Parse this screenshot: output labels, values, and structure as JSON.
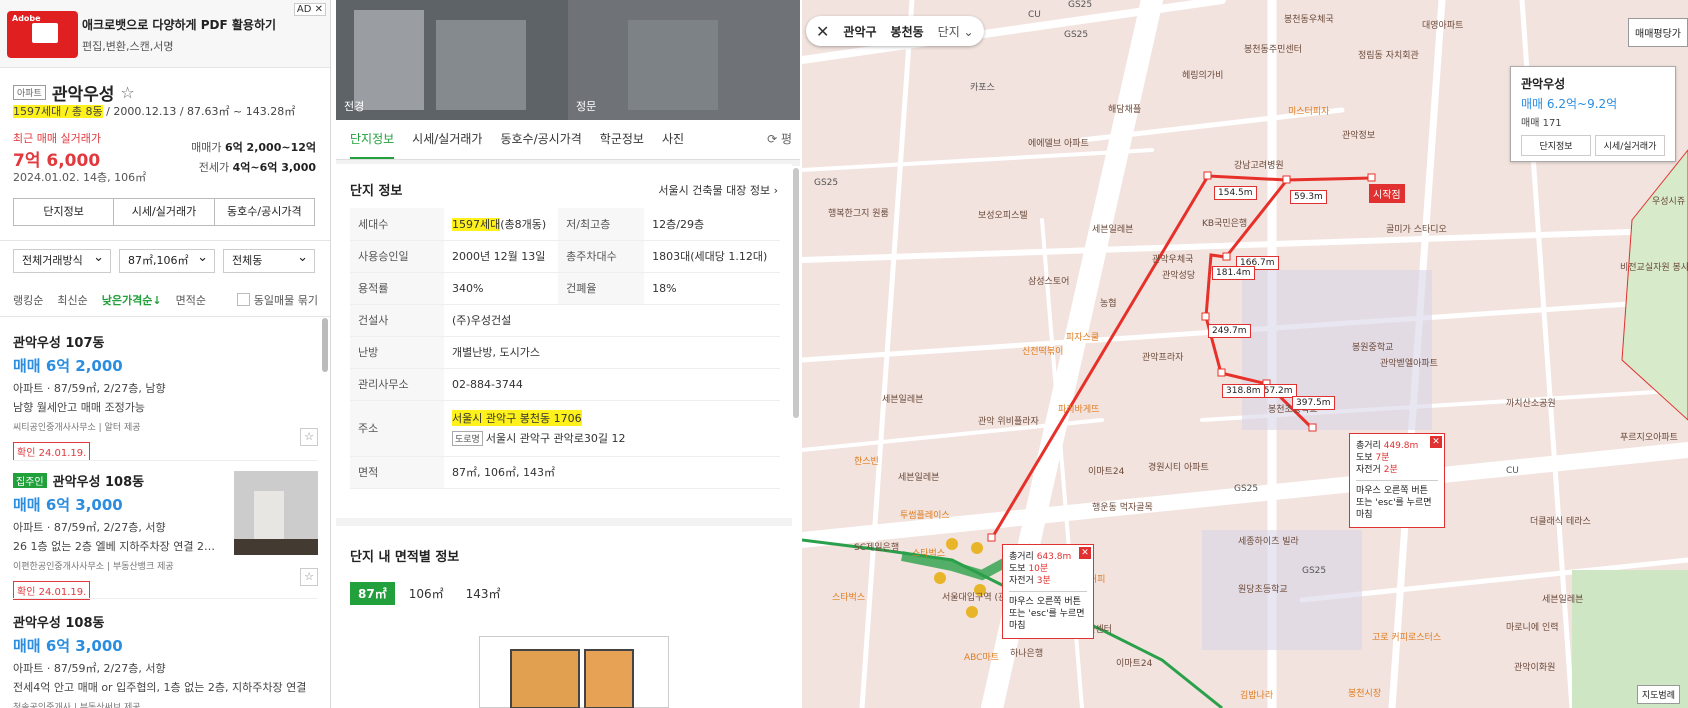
{
  "ad": {
    "title": "애크로뱃으로 다양하게 PDF 활용하기",
    "desc": "편집,변환,스캔,서명",
    "close": "AD ✕",
    "logo": "Adobe"
  },
  "complex": {
    "tag": "아파트",
    "name": "관악우성",
    "units_hl": "1597세대 / 총 8동",
    "spec_rest": " / 2000.12.13 / 87.63㎡ ~ 143.28㎡",
    "recent_label": "최근 매매 실거래가",
    "recent_price": "7억 6,000",
    "recent_date": "2024.01.02. 14층, 106㎡",
    "sale_label": "매매가",
    "sale_value": "6억 2,000~12억",
    "jeonse_label": "전세가",
    "jeonse_value": "4억~6억 3,000"
  },
  "left_buttons": [
    "단지정보",
    "시세/실거래가",
    "동호수/공시가격"
  ],
  "filters": [
    "전체거래방식",
    "87㎡,106㎡",
    "전체동"
  ],
  "sorts": {
    "items": [
      "랭킹순",
      "최신순",
      "낮은가격순↓",
      "면적순"
    ],
    "same": "동일매물 묶기"
  },
  "listings": [
    {
      "title": "관악우성 107동",
      "price": "매매 6억 2,000",
      "spec": "아파트 · 87/59㎡, 2/27층, 남향",
      "desc": "남향 월세안고 매매 조정가능",
      "src": "씨티공인중개사사무소 | 알터 제공",
      "check": "확인 24.01.19."
    },
    {
      "badge": "집주인",
      "title": "관악우성 108동",
      "price": "매매 6억 3,000",
      "spec": "아파트 · 87/59㎡, 2/27층, 서향",
      "desc": "26 1층 없는 2층 엘베 지하주차장 연결 2호...",
      "src": "이편한공인중개사사무소 | 부동산뱅크 제공",
      "check": "확인 24.01.19."
    },
    {
      "title": "관악우성 108동",
      "price": "매매 6억 3,000",
      "spec": "아파트 · 87/59㎡, 2/27층, 서향",
      "desc": "전세4억 안고 매매 or 입주협의, 1층 없는 2층, 지하주차장 연결",
      "src": "청솔공인중개사 | 부동산써브 제공"
    }
  ],
  "photos": [
    "전경",
    "정문"
  ],
  "tabs": [
    "단지정보",
    "시세/실거래가",
    "동호수/공시가격",
    "학군정보",
    "사진",
    "⟳ 평"
  ],
  "info": {
    "title": "단지 정보",
    "bldg_link": "서울시 건축물 대장 정보 ›",
    "rows": [
      {
        "k": "세대수",
        "v_hl": "1597세대",
        "v": "(총8개동)",
        "k2": "저/최고층",
        "v2": "12층/29층"
      },
      {
        "k": "사용승인일",
        "v": "2000년 12월 13일",
        "k2": "총주차대수",
        "v2": "1803대(세대당 1.12대)"
      },
      {
        "k": "용적률",
        "v": "340%",
        "k2": "건폐율",
        "v2": "18%"
      },
      {
        "k": "건설사",
        "v": "(주)우성건설"
      },
      {
        "k": "난방",
        "v": "개별난방, 도시가스"
      },
      {
        "k": "관리사무소",
        "v": "02-884-3744"
      },
      {
        "k": "주소",
        "v_hl": "서울시 관악구 봉천동 1706",
        "road": "도로명",
        "road_addr": "서울시 관악구 관악로30길 12"
      },
      {
        "k": "면적",
        "v": "87㎡, 106㎡, 143㎡"
      }
    ]
  },
  "area": {
    "title": "단지 내 면적별 정보",
    "tabs": [
      "87㎡",
      "106㎡",
      "143㎡"
    ]
  },
  "map": {
    "crumb": [
      "관악구",
      "봉천동",
      "단지 ⌄"
    ],
    "top_btn": "매매평당가",
    "card": {
      "name": "관악우성",
      "price": "매매 6.2억~9.2억",
      "count": "매매 171",
      "btn1": "단지정보",
      "btn2": "시세/실거래가"
    },
    "distances": [
      "154.5m",
      "59.3m",
      "166.7m",
      "181.4m",
      "249.7m",
      "318.8m",
      "357.2m",
      "397.5m"
    ],
    "start": "시작점",
    "popup1": {
      "total_l": "총거리",
      "total_v": "449.8m",
      "walk_l": "도보",
      "walk_v": "7분",
      "bike_l": "자전거",
      "bike_v": "2분",
      "hint": "마우스 오른쪽 버튼 또는 'esc'를 누르면 마침"
    },
    "popup2": {
      "total_l": "총거리",
      "total_v": "643.8m",
      "walk_l": "도보",
      "walk_v": "10분",
      "bike_l": "자전거",
      "bike_v": "3분",
      "hint": "마우스 오른쪽 버튼 또는 'esc'를 누르면 마침"
    },
    "scale": "지도범례",
    "pois": [
      "GS25",
      "CU",
      "카포스",
      "에에델브 아파트",
      "해담채플",
      "헤링의가비",
      "GS25",
      "봉천동주민센터",
      "봉천동우체국",
      "정림동 자치회관",
      "대영아파트",
      "미스터피자",
      "강남고려병원",
      "관악정보",
      "행복한그지 원룸",
      "보성오피스텔",
      "세븐일레븐",
      "KB국민은행",
      "골미가 스타디오",
      "관악우체국",
      "관악성당",
      "삼성스토어",
      "농협",
      "피자스쿨",
      "신전떡볶이",
      "관악프라자",
      "봉원중학교",
      "관악벧엘아파트",
      "세븐일레븐",
      "관악 위비플라자",
      "파리바게뜨",
      "한스빈",
      "봉천초등학교",
      "까치산소공원",
      "세븐일레븐",
      "이마트24",
      "경원시티 아파트",
      "행운동 먹자골목",
      "GS25",
      "서울대입구역 (관악구청)",
      "스타벅스",
      "SC제일은행",
      "투썸플레이스",
      "이디야커피",
      "원당초등학교",
      "세종하이츠 빌라",
      "행운동주민센터",
      "하나은행",
      "ABC마트",
      "이마트24",
      "고로 커피로스터스",
      "김밥나라",
      "봉천시장",
      "더클래식 테라스",
      "푸르지오아파트",
      "CU",
      "우성시쥬",
      "비전교실자원 봉사센터",
      "스타벅스",
      "세븐일레븐",
      "GS25",
      "마로니에 인력",
      "관악이화원",
      "GS25"
    ]
  }
}
